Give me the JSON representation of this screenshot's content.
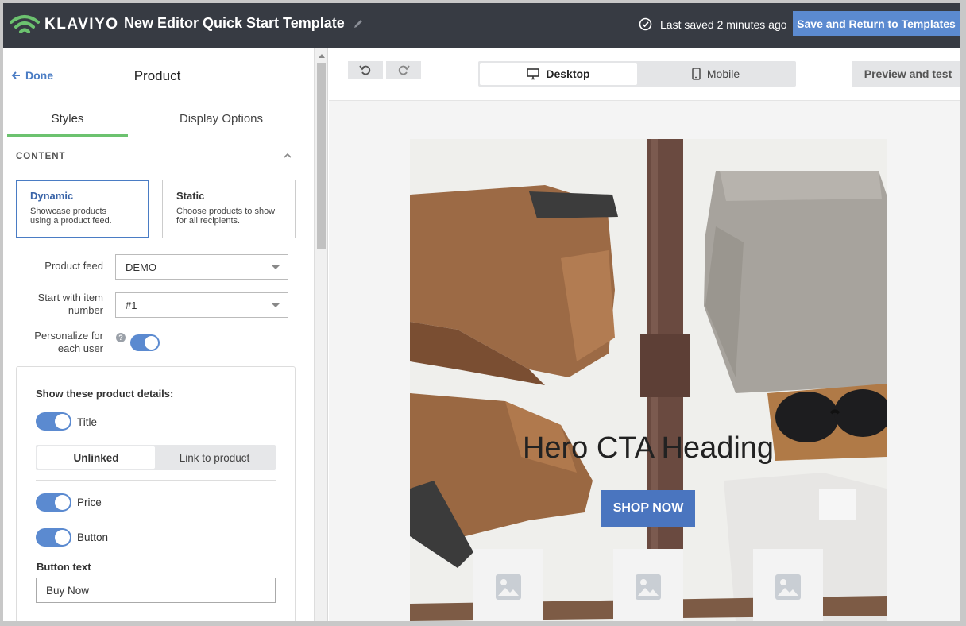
{
  "header": {
    "brand": "KLAVIYO",
    "document_title": "New Editor Quick Start Template",
    "saved_status": "Last saved 2 minutes ago",
    "save_button": "Save and Return to Templates"
  },
  "panel": {
    "done_label": "Done",
    "title": "Product",
    "tabs": [
      "Styles",
      "Display Options"
    ],
    "section_header": "CONTENT",
    "choices": [
      {
        "title": "Dynamic",
        "desc": "Showcase products using a product feed."
      },
      {
        "title": "Static",
        "desc": "Choose products to show for all recipients."
      }
    ],
    "product_feed_label": "Product feed",
    "product_feed_value": "DEMO",
    "start_item_label": "Start with item number",
    "start_item_value": "#1",
    "personalize_label": "Personalize for each user",
    "help_glyph": "?",
    "details_title": "Show these product details:",
    "title_toggle": "Title",
    "link_options": [
      "Unlinked",
      "Link to product"
    ],
    "price_toggle": "Price",
    "button_toggle": "Button",
    "button_text_label": "Button text",
    "button_text_value": "Buy Now"
  },
  "editor": {
    "device_options": [
      "Desktop",
      "Mobile"
    ],
    "preview_button": "Preview and test",
    "hero_heading": "Hero CTA Heading",
    "hero_button": "SHOP NOW"
  },
  "colors": {
    "topbar": "#373b43",
    "accent_blue": "#5b8ad0",
    "tab_active_green": "#6cc26f",
    "hero_button": "#4a75bf"
  }
}
